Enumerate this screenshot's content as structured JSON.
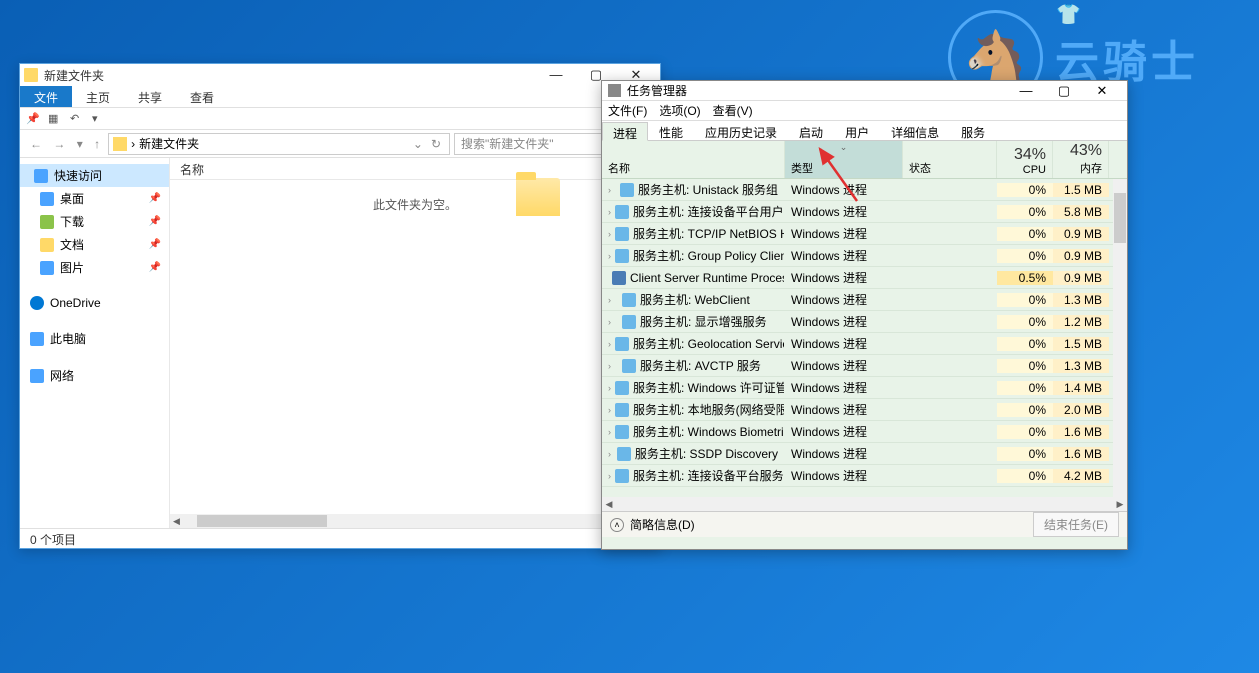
{
  "watermark": {
    "text": "云骑士",
    "emoji": "👕",
    "knight": "🐴"
  },
  "explorer": {
    "title": "新建文件夹",
    "tabs": {
      "file": "文件",
      "home": "主页",
      "share": "共享",
      "view": "查看"
    },
    "path": "新建文件夹",
    "path_chevron": "›",
    "search_placeholder": "搜索\"新建文件夹\"",
    "content_header": "名称",
    "empty": "此文件夹为空。",
    "sidebar": {
      "quick": "快速访问",
      "items": [
        {
          "label": "桌面",
          "cls": "desktop",
          "pin": true
        },
        {
          "label": "下载",
          "cls": "download",
          "pin": true
        },
        {
          "label": "文档",
          "cls": "docs",
          "pin": true
        },
        {
          "label": "图片",
          "cls": "pics",
          "pin": true
        }
      ],
      "onedrive": "OneDrive",
      "pc": "此电脑",
      "network": "网络"
    },
    "status": "0 个项目"
  },
  "taskmgr": {
    "title": "任务管理器",
    "menu": {
      "file": "文件(F)",
      "options": "选项(O)",
      "view": "查看(V)"
    },
    "tabs": [
      "进程",
      "性能",
      "应用历史记录",
      "启动",
      "用户",
      "详细信息",
      "服务"
    ],
    "active_tab": 0,
    "columns": {
      "name": "名称",
      "type": "类型",
      "status": "状态",
      "cpu": "CPU",
      "mem": "内存",
      "cpu_pct": "34%",
      "mem_pct": "43%"
    },
    "rows": [
      {
        "exp": true,
        "name": "服务主机: Unistack 服务组",
        "type": "Windows 进程",
        "cpu": "0%",
        "mem": "1.5 MB"
      },
      {
        "exp": true,
        "name": "服务主机: 连接设备平台用户服...",
        "type": "Windows 进程",
        "cpu": "0%",
        "mem": "5.8 MB"
      },
      {
        "exp": true,
        "name": "服务主机: TCP/IP NetBIOS Hel...",
        "type": "Windows 进程",
        "cpu": "0%",
        "mem": "0.9 MB"
      },
      {
        "exp": true,
        "name": "服务主机: Group Policy Client",
        "type": "Windows 进程",
        "cpu": "0%",
        "mem": "0.9 MB"
      },
      {
        "exp": false,
        "alt": true,
        "name": "Client Server Runtime Process",
        "type": "Windows 进程",
        "cpu": "0.5%",
        "cpu_hi": true,
        "mem": "0.9 MB"
      },
      {
        "exp": true,
        "name": "服务主机: WebClient",
        "type": "Windows 进程",
        "cpu": "0%",
        "mem": "1.3 MB"
      },
      {
        "exp": true,
        "name": "服务主机: 显示增强服务",
        "type": "Windows 进程",
        "cpu": "0%",
        "mem": "1.2 MB"
      },
      {
        "exp": true,
        "name": "服务主机: Geolocation Service",
        "type": "Windows 进程",
        "cpu": "0%",
        "mem": "1.5 MB"
      },
      {
        "exp": true,
        "name": "服务主机: AVCTP 服务",
        "type": "Windows 进程",
        "cpu": "0%",
        "mem": "1.3 MB"
      },
      {
        "exp": true,
        "name": "服务主机: Windows 许可证管...",
        "type": "Windows 进程",
        "cpu": "0%",
        "mem": "1.4 MB"
      },
      {
        "exp": true,
        "name": "服务主机: 本地服务(网络受限)",
        "type": "Windows 进程",
        "cpu": "0%",
        "mem": "2.0 MB"
      },
      {
        "exp": true,
        "name": "服务主机: Windows Biometric...",
        "type": "Windows 进程",
        "cpu": "0%",
        "mem": "1.6 MB"
      },
      {
        "exp": true,
        "name": "服务主机: SSDP Discovery",
        "type": "Windows 进程",
        "cpu": "0%",
        "mem": "1.6 MB"
      },
      {
        "exp": true,
        "name": "服务主机: 连接设备平台服务",
        "type": "Windows 进程",
        "cpu": "0%",
        "mem": "4.2 MB"
      }
    ],
    "fewer": "简略信息(D)",
    "endtask": "结束任务(E)"
  }
}
